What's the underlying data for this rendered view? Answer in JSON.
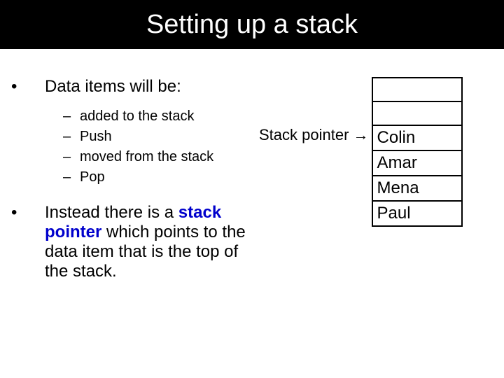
{
  "title": "Setting up a stack",
  "bullet1": "Data items will be:",
  "sub": {
    "a": "added to the stack",
    "b": "Push",
    "c": "moved from the stack",
    "d": "Pop"
  },
  "bullet2_pre": "Instead there is a ",
  "bullet2_bold": "stack pointer",
  "bullet2_post": " which points to the data item that is the top of the stack.",
  "pointer_label": "Stack pointer →",
  "stack": {
    "cell0": "",
    "cell1": "",
    "cell2": "Colin",
    "cell3": "Amar",
    "cell4": "Mena",
    "cell5": "Paul"
  }
}
